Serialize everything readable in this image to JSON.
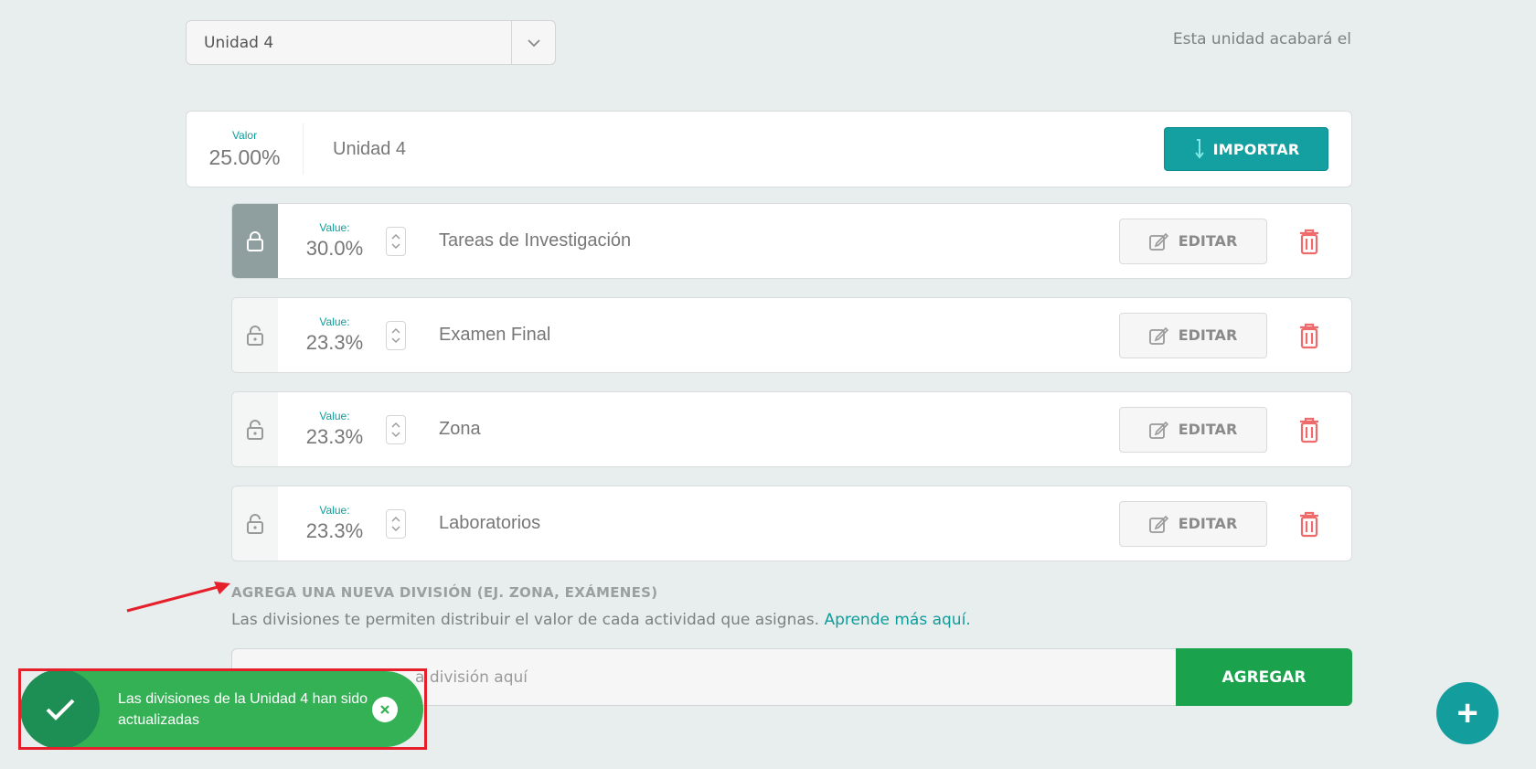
{
  "unit_select": {
    "value": "Unidad 4"
  },
  "end_text": "Esta unidad acabará el",
  "unit_card": {
    "valor_label": "Valor",
    "valor": "25.00%",
    "name": "Unidad 4",
    "import_label": "IMPORTAR"
  },
  "divisions": [
    {
      "value_label": "Value:",
      "value": "30.0%",
      "name": "Tareas de Investigación",
      "locked": true,
      "edit_label": "EDITAR"
    },
    {
      "value_label": "Value:",
      "value": "23.3%",
      "name": "Examen Final",
      "locked": false,
      "edit_label": "EDITAR"
    },
    {
      "value_label": "Value:",
      "value": "23.3%",
      "name": "Zona",
      "locked": false,
      "edit_label": "EDITAR"
    },
    {
      "value_label": "Value:",
      "value": "23.3%",
      "name": "Laboratorios",
      "locked": false,
      "edit_label": "EDITAR"
    }
  ],
  "add_section": {
    "title": "AGREGA UNA NUEVA DIVISIÓN (EJ. ZONA, EXÁMENES)",
    "description": "Las divisiones te permiten distribuir el valor de cada actividad que asignas.",
    "link": "Aprende más aquí.",
    "input_value": "a división aquí",
    "button_label": "AGREGAR"
  },
  "toast": {
    "message": "Las divisiones de la Unidad 4 han sido actualizadas"
  },
  "fab_label": "+",
  "colors": {
    "accent": "#14a0a0",
    "success": "#35b155",
    "danger": "#e5202a"
  }
}
